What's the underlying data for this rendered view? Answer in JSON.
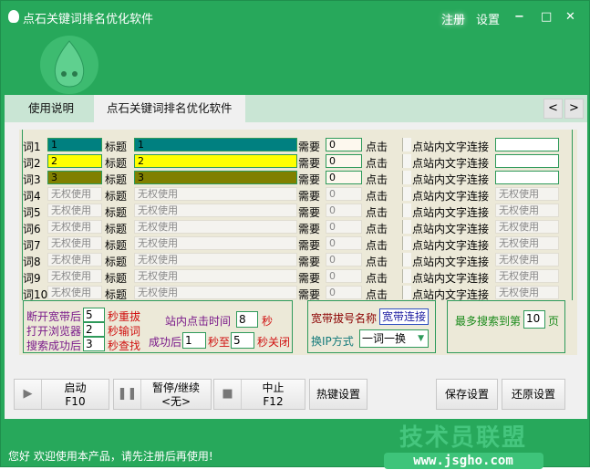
{
  "window": {
    "title": "点石关键词排名优化软件",
    "register": "注册",
    "settings": "设置",
    "minimize": "−",
    "maximize": "□",
    "close": "✕"
  },
  "tabs": [
    {
      "label": "使用说明"
    },
    {
      "label": "点石关键词排名优化软件"
    }
  ],
  "tab_nav": {
    "prev": "<",
    "next": ">"
  },
  "colors": {
    "row1": "#008080",
    "row2": "#ffff00",
    "row3": "#808000",
    "brand": "#27a85b"
  },
  "rows": [
    {
      "label": "词1",
      "word": "1",
      "title_label": "标题",
      "title": "1",
      "need": "需要",
      "count": "0",
      "click": "点击",
      "link_label": "点站内文字连接",
      "link": ""
    },
    {
      "label": "词2",
      "word": "2",
      "title_label": "标题",
      "title": "2",
      "need": "需要",
      "count": "0",
      "click": "点击",
      "link_label": "点站内文字连接",
      "link": ""
    },
    {
      "label": "词3",
      "word": "3",
      "title_label": "标题",
      "title": "3",
      "need": "需要",
      "count": "0",
      "click": "点击",
      "link_label": "点站内文字连接",
      "link": ""
    },
    {
      "label": "词4",
      "word": "无权使用",
      "title_label": "标题",
      "title": "无权使用",
      "need": "需要",
      "count": "0",
      "click": "点击",
      "link_label": "点站内文字连接",
      "link": "无权使用"
    },
    {
      "label": "词5",
      "word": "无权使用",
      "title_label": "标题",
      "title": "无权使用",
      "need": "需要",
      "count": "0",
      "click": "点击",
      "link_label": "点站内文字连接",
      "link": "无权使用"
    },
    {
      "label": "词6",
      "word": "无权使用",
      "title_label": "标题",
      "title": "无权使用",
      "need": "需要",
      "count": "0",
      "click": "点击",
      "link_label": "点站内文字连接",
      "link": "无权使用"
    },
    {
      "label": "词7",
      "word": "无权使用",
      "title_label": "标题",
      "title": "无权使用",
      "need": "需要",
      "count": "0",
      "click": "点击",
      "link_label": "点站内文字连接",
      "link": "无权使用"
    },
    {
      "label": "词8",
      "word": "无权使用",
      "title_label": "标题",
      "title": "无权使用",
      "need": "需要",
      "count": "0",
      "click": "点击",
      "link_label": "点站内文字连接",
      "link": "无权使用"
    },
    {
      "label": "词9",
      "word": "无权使用",
      "title_label": "标题",
      "title": "无权使用",
      "need": "需要",
      "count": "0",
      "click": "点击",
      "link_label": "点站内文字连接",
      "link": "无权使用"
    },
    {
      "label": "词10",
      "word": "无权使用",
      "title_label": "标题",
      "title": "无权使用",
      "need": "需要",
      "count": "0",
      "click": "点击",
      "link_label": "点站内文字连接",
      "link": "无权使用"
    }
  ],
  "timing": {
    "disconnect_label": "断开宽带后",
    "disconnect": "5",
    "redial": "秒重拔",
    "open_browser_label": "打开浏览器",
    "open_browser": "2",
    "input_word": "秒输词",
    "found_label": "搜索成功后",
    "found": "3",
    "search": "秒查找",
    "click_time_label": "站内点击时间",
    "click_time": "8",
    "sec": "秒",
    "success_label": "成功后",
    "close_min": "1",
    "to": "秒至",
    "close_max": "5",
    "close": "秒关闭"
  },
  "network": {
    "dial_label": "宽带拔号名称",
    "dial_name": "宽带连接",
    "ip_label": "换IP方式",
    "ip_mode": "一词一换",
    "arrow": "▼"
  },
  "search": {
    "max_label": "最多搜索到第",
    "max_pages": "10",
    "page": "页"
  },
  "buttons": {
    "start": "启动",
    "start_key": "F10",
    "pause": "暂停/继续",
    "pause_key": "<无>",
    "stop": "中止",
    "stop_key": "F12",
    "hotkey": "热键设置",
    "save": "保存设置",
    "restore": "还原设置"
  },
  "status": "您好 欢迎使用本产品，请先注册后再使用!",
  "watermark": {
    "text": "技术员联盟",
    "url": "www.jsgho.com"
  }
}
